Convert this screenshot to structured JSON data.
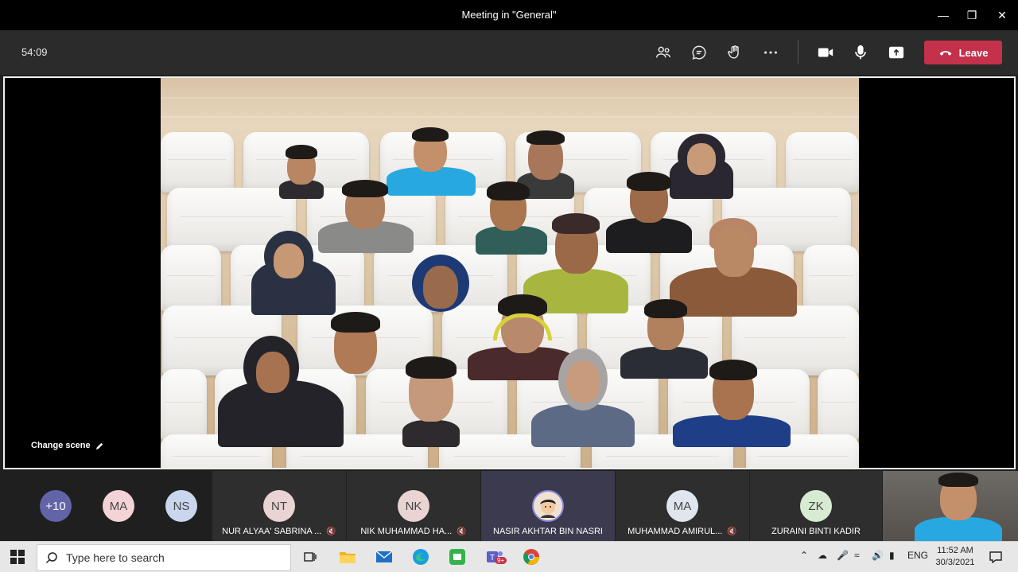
{
  "window": {
    "title": "Meeting in \"General\"",
    "minimize_icon": "minimize-icon",
    "maximize_icon": "maximize-icon",
    "close_icon": "close-icon"
  },
  "toolbar": {
    "timer": "54:09",
    "buttons": [
      "participants-icon",
      "chat-icon",
      "raise-hand-icon",
      "more-options-icon",
      "camera-icon",
      "microphone-icon",
      "share-screen-icon"
    ],
    "leave_label": "Leave",
    "leave_color": "#c4314b"
  },
  "stage": {
    "change_scene_label": "Change scene",
    "scene": "together-mode-auditorium"
  },
  "roster": {
    "overflow": {
      "label": "+10",
      "color": "#6264a7"
    },
    "small_avatars": [
      {
        "initials": "MA",
        "color": "#f3d3d6"
      },
      {
        "initials": "NS",
        "color": "#c9d6ee"
      }
    ],
    "tiles": [
      {
        "initials": "NT",
        "name": "NUR ALYAA' SABRINA ...",
        "muted": true
      },
      {
        "initials": "NK",
        "name": "NIK MUHAMMAD HA...",
        "muted": true
      },
      {
        "initials": "",
        "name": "NASIR AKHTAR BIN NASRI",
        "muted": false,
        "photo": true
      },
      {
        "initials": "MA",
        "name": "MUHAMMAD AMIRUL...",
        "muted": true
      },
      {
        "initials": "ZK",
        "name": "ZURAINI BINTI KADIR",
        "muted": false
      }
    ]
  },
  "taskbar": {
    "search_placeholder": "Type here to search",
    "teams_badge": "9+",
    "language": "ENG",
    "time": "11:52 AM",
    "date": "30/3/2021"
  }
}
